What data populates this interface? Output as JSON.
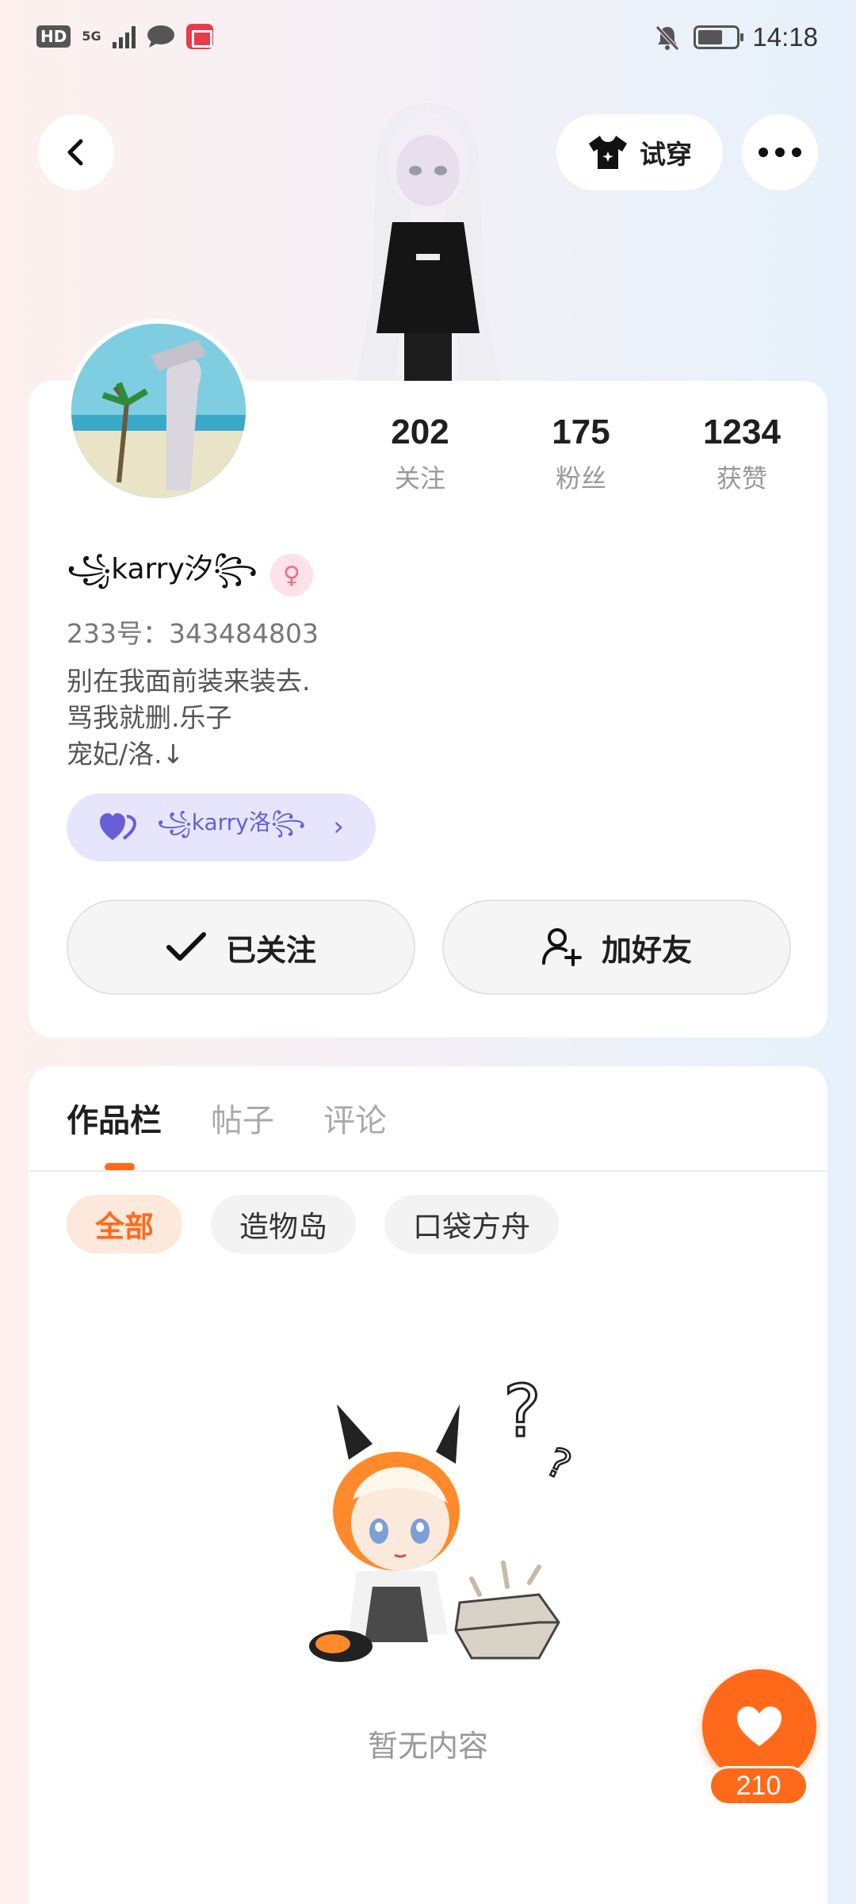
{
  "status_bar": {
    "hd": "HD",
    "network": "5G",
    "time": "14:18"
  },
  "header": {
    "tryon_label": "试穿"
  },
  "profile": {
    "nickname": "꧁karry汐꧂",
    "gender_symbol": "♀",
    "uid": "233号：343484803",
    "bio_lines": [
      "别在我面前装来装去.",
      "骂我就删.乐子",
      "宠妃/洛.↓"
    ],
    "couple_name": "꧁karry洛꧂"
  },
  "stats": [
    {
      "value": "202",
      "label": "关注"
    },
    {
      "value": "175",
      "label": "粉丝"
    },
    {
      "value": "1234",
      "label": "获赞"
    }
  ],
  "actions": {
    "followed_label": "已关注",
    "add_friend_label": "加好友"
  },
  "works": {
    "tabs": [
      "作品栏",
      "帖子",
      "评论"
    ],
    "filters": [
      "全部",
      "造物岛",
      "口袋方舟"
    ],
    "empty_text": "暂无内容"
  },
  "like_fab": {
    "count": "210"
  },
  "colors": {
    "accent": "#ff6a1a",
    "couple_tag": "#e7e5fc",
    "gender_pink": "#f06b90"
  }
}
